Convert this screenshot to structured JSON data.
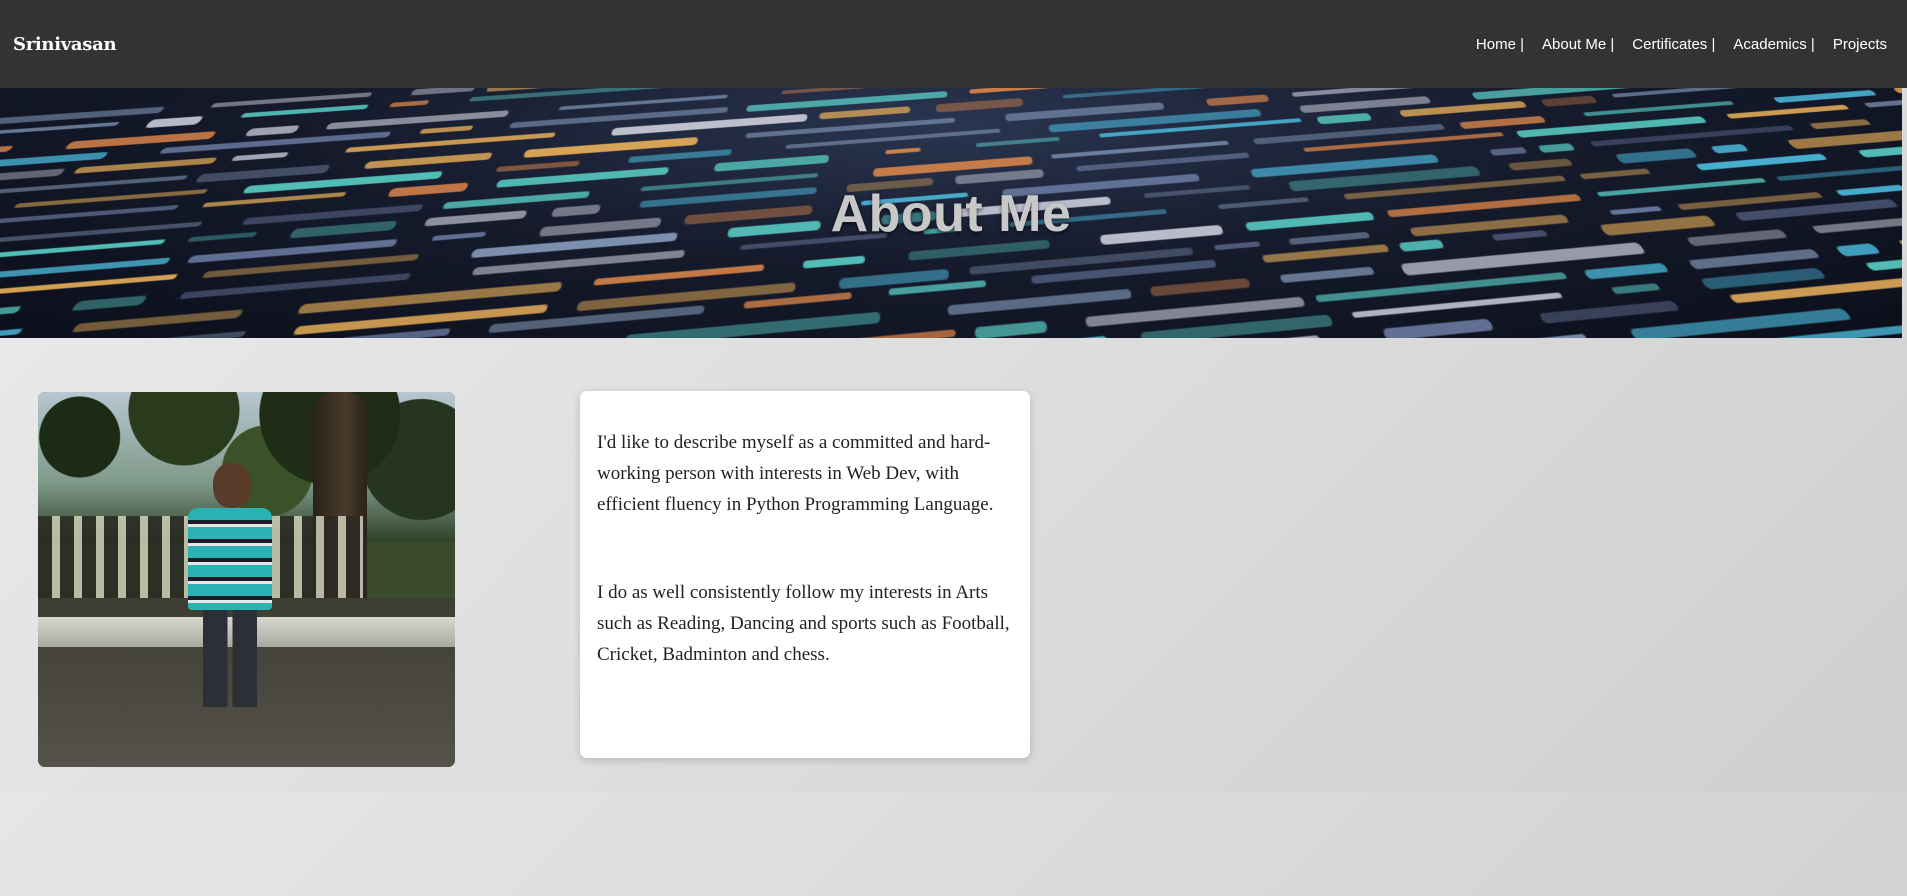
{
  "navbar": {
    "brand": "Srinivasan",
    "links": [
      {
        "label": "Home |"
      },
      {
        "label": "About Me |"
      },
      {
        "label": "Certificates |"
      },
      {
        "label": "Academics |"
      },
      {
        "label": "Projects"
      }
    ]
  },
  "hero": {
    "title": "About Me"
  },
  "about": {
    "photo_alt": "Photo of Srinivasan",
    "paragraphs": [
      "I'd like to describe myself as a committed and hard-working person with interests in Web Dev, with efficient fluency in Python Programming Language.",
      "I do as well consistently follow my interests in Arts such as Reading, Dancing and sports such as Football, Cricket, Badminton and chess."
    ]
  },
  "colors": {
    "navbar_bg": "#333333",
    "nav_text": "#ffffff",
    "hero_title": "#c8c8c8",
    "card_bg": "#ffffff",
    "body_text": "#222222"
  }
}
